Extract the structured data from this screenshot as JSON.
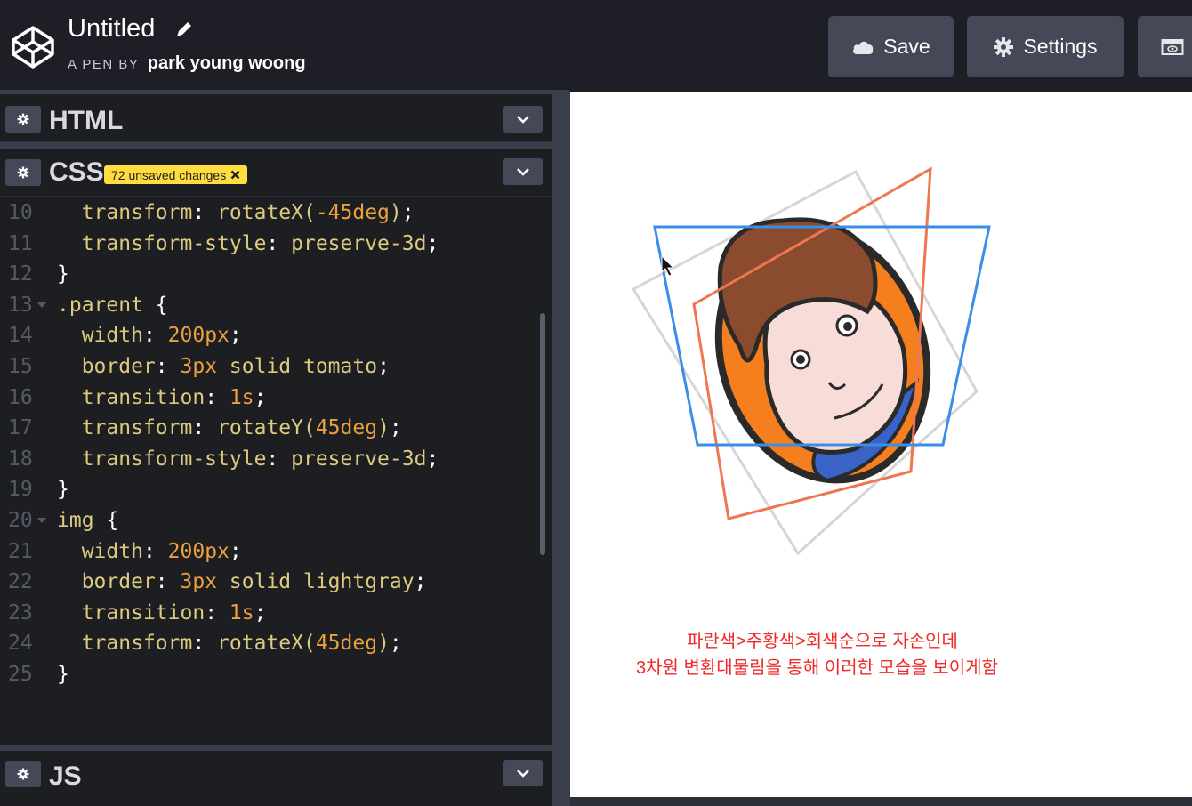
{
  "header": {
    "title": "Untitled",
    "byline_prefix": "A PEN BY",
    "author": "park young woong",
    "save_label": "Save",
    "settings_label": "Settings"
  },
  "panels": {
    "html_label": "HTML",
    "css_label": "CSS",
    "css_badge": "72 unsaved changes",
    "js_label": "JS"
  },
  "code_lines": [
    {
      "num": "10",
      "text": "  transform: rotateX(-45deg);"
    },
    {
      "num": "11",
      "text": "  transform-style: preserve-3d;"
    },
    {
      "num": "12",
      "text": "}"
    },
    {
      "num": "13",
      "text": ".parent {"
    },
    {
      "num": "14",
      "text": "  width: 200px;"
    },
    {
      "num": "15",
      "text": "  border: 3px solid tomato;"
    },
    {
      "num": "16",
      "text": "  transition: 1s;"
    },
    {
      "num": "17",
      "text": "  transform: rotateY(45deg);"
    },
    {
      "num": "18",
      "text": "  transform-style: preserve-3d;"
    },
    {
      "num": "19",
      "text": "}"
    },
    {
      "num": "20",
      "text": "img {"
    },
    {
      "num": "21",
      "text": "  width: 200px;"
    },
    {
      "num": "22",
      "text": "  border: 3px solid lightgray;"
    },
    {
      "num": "23",
      "text": "  transition: 1s;"
    },
    {
      "num": "24",
      "text": "  transform: rotateX(45deg);"
    },
    {
      "num": "25",
      "text": "}"
    }
  ],
  "preview": {
    "note_line1": "파란색>주황색>회색순으로 자손인데",
    "note_line2": "3차원 변환대물림을 통해 이러한 모습을 보이게함"
  },
  "colors": {
    "blue_border": "#3a8ee6",
    "tomato_border": "#ee7650",
    "gray_border": "#d3d3d3",
    "badge": "#ffdd40",
    "note": "#ee2a2a"
  }
}
